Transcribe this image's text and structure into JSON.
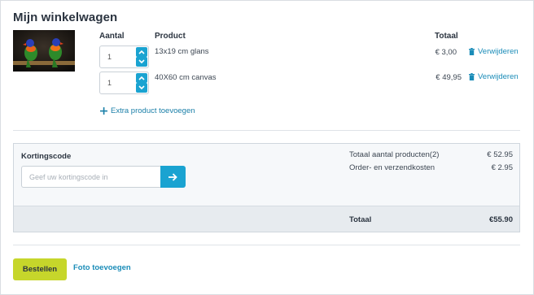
{
  "cart": {
    "title": "Mijn winkelwagen",
    "columns": {
      "quantity": "Aantal",
      "product": "Product",
      "total": "Totaal"
    },
    "items": [
      {
        "quantity": "1",
        "name": "13x19 cm glans",
        "price": "€ 3,00",
        "remove_label": "Verwijderen"
      },
      {
        "quantity": "1",
        "name": "40X60 cm canvas",
        "price": "€ 49,95",
        "remove_label": "Verwijderen"
      }
    ],
    "add_extra_label": "Extra product toevoegen"
  },
  "discount": {
    "label": "Kortingscode",
    "placeholder": "Geef uw kortingscode in"
  },
  "summary": {
    "products_label": "Totaal aantal producten",
    "products_count": "(2)",
    "products_value": "€ 52.95",
    "shipping_label": "Order- en verzendkosten",
    "shipping_value": "€ 2.95",
    "total_label": "Totaal",
    "total_value": "€55.90"
  },
  "actions": {
    "order_label": "Bestellen",
    "add_photo_label": "Foto toevoegen"
  },
  "colors": {
    "accent_blue": "#1aa3d1",
    "link_blue": "#1a8cb8",
    "order_green": "#c6d62b"
  },
  "icons": {
    "stepper_up": "chevron-up-icon",
    "stepper_down": "chevron-down-icon",
    "remove": "trash-icon",
    "add": "plus-icon",
    "submit": "arrow-right-icon"
  }
}
